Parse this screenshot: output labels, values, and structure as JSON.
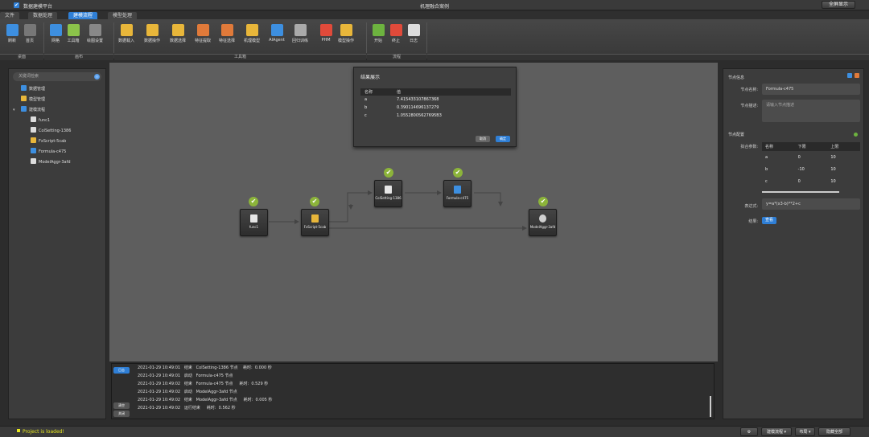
{
  "window": {
    "app_name": "数据建模平台",
    "title": "机理融合案例",
    "fullscreen_label": "全屏显示",
    "checkbox_mark": "✔"
  },
  "tabs": [
    {
      "label": "文件"
    },
    {
      "label": "数据处理"
    },
    {
      "label": "建模流程"
    },
    {
      "label": "模型处理"
    }
  ],
  "ribbon": {
    "buttons": [
      {
        "label": "刷新",
        "icon": "refresh-icon",
        "color": "#3d8fe0"
      },
      {
        "label": "首页",
        "icon": "home-icon",
        "color": "#777777"
      },
      {
        "label": "网格",
        "icon": "grid-icon",
        "color": "#3d8fe0"
      },
      {
        "label": "工具箱",
        "icon": "toolbox-icon",
        "color": "#8bc34a"
      },
      {
        "label": "绘图设置",
        "icon": "gear-icon",
        "color": "#888888"
      },
      {
        "label": "数据载入",
        "icon": "data-load-icon",
        "color": "#e8b63a"
      },
      {
        "label": "数据操作",
        "icon": "data-op-icon",
        "color": "#e8b63a"
      },
      {
        "label": "数据选择",
        "icon": "data-select-icon",
        "color": "#e8b63a"
      },
      {
        "label": "特征提取",
        "icon": "feature-extract-icon",
        "color": "#e07a3a"
      },
      {
        "label": "特征选择",
        "icon": "feature-select-icon",
        "color": "#e07a3a"
      },
      {
        "label": "机理模型",
        "icon": "mechanism-model-icon",
        "color": "#e8b63a"
      },
      {
        "label": "AIAgent",
        "icon": "ai-agent-icon",
        "color": "#3d8fe0"
      },
      {
        "label": "回归训练",
        "icon": "regression-icon",
        "color": "#aaaaaa"
      },
      {
        "label": "PHM",
        "icon": "phm-icon",
        "color": "#e04a3a"
      },
      {
        "label": "模型操作",
        "icon": "model-op-icon",
        "color": "#e8b63a"
      },
      {
        "label": "开始",
        "icon": "play-icon",
        "color": "#6db33f"
      },
      {
        "label": "终止",
        "icon": "stop-icon",
        "color": "#e04a3a"
      },
      {
        "label": "日志",
        "icon": "log-icon",
        "color": "#dddddd"
      }
    ],
    "groups": [
      "桌面",
      "画布",
      "工具箱",
      "流程"
    ]
  },
  "left_panel": {
    "search_placeholder": "关键词检索",
    "tree": [
      {
        "label": "数据管理",
        "icon": "data-manage-icon",
        "color": "#3d8fe0",
        "level": 1
      },
      {
        "label": "模型管理",
        "icon": "model-manage-icon",
        "color": "#e8b63a",
        "level": 1
      },
      {
        "label": "建模流程",
        "icon": "flow-icon",
        "color": "#3d8fe0",
        "level": 1,
        "expanded": true
      },
      {
        "label": "func1",
        "icon": "file-icon",
        "color": "#dddddd",
        "level": 2
      },
      {
        "label": "ColSetting-1386",
        "icon": "col-setting-icon",
        "color": "#dddddd",
        "level": 2
      },
      {
        "label": "FxScript-5cab",
        "icon": "script-icon",
        "color": "#e8b63a",
        "level": 2
      },
      {
        "label": "Formula-c475",
        "icon": "formula-icon",
        "color": "#3d8fe0",
        "level": 2
      },
      {
        "label": "ModelAggr-3afd",
        "icon": "model-aggr-icon",
        "color": "#dddddd",
        "level": 2
      }
    ]
  },
  "canvas": {
    "nodes": [
      {
        "id": "func1",
        "label": "func1"
      },
      {
        "id": "fxscript",
        "label": "FxScript-5cab"
      },
      {
        "id": "colsetting",
        "label": "ColSetting-1386"
      },
      {
        "id": "formula",
        "label": "Formula-c475"
      },
      {
        "id": "modelaggr",
        "label": "ModelAggr-3afd"
      }
    ],
    "ok_mark": "✔"
  },
  "result_dialog": {
    "title": "结果展示",
    "headers": [
      "名称",
      "值"
    ],
    "rows": [
      {
        "name": "a",
        "value": "7.415433107867368"
      },
      {
        "name": "b",
        "value": "0.390114696137279"
      },
      {
        "name": "c",
        "value": "1.05528005627695B3"
      }
    ],
    "cancel_label": "取消",
    "ok_label": "确定"
  },
  "log_panel": {
    "log_tab": "日志",
    "clear_label": "清空",
    "close_label": "关闭",
    "lines": [
      "2021-01-29 10:49:01   结束   ColSetting-1386 节点    耗时:  0.000 秒",
      "2021-01-29 10:49:01   启动   Formula-c475 节点",
      "2021-01-29 10:49:02   结束   Formula-c475 节点     耗时:  0.529 秒",
      "2021-01-29 10:49:02   启动   ModelAggr-3afd 节点",
      "2021-01-29 10:49:02   结束   ModelAggr-3afd 节点     耗时:  0.005 秒",
      "2021-01-29 10:49:02   运行结束     耗时:  0.562 秒"
    ]
  },
  "right_panel": {
    "info_title": "节点信息",
    "name_label": "节点名称:",
    "name_value": "Formula-c475",
    "desc_label": "节点描述:",
    "desc_placeholder": "请输入节点描述",
    "config_title": "节点配置",
    "params_label": "拟合参数:",
    "param_headers": [
      "名称",
      "下限",
      "上限"
    ],
    "params": [
      {
        "name": "a",
        "low": "0",
        "high": "10"
      },
      {
        "name": "b",
        "low": "-10",
        "high": "10"
      },
      {
        "name": "c",
        "low": "0",
        "high": "10"
      }
    ],
    "expr_label": "表达式:",
    "expr_value": "y=a*(x3-b)**2+c",
    "result_label": "结果:",
    "view_label": "查看"
  },
  "status_bar": {
    "message": "Project is loaded!",
    "gear_icon": "⚙",
    "flow_btn": "建模流程 ▾",
    "layout_btn": "布局 ▾",
    "hide_all": "隐藏全部"
  }
}
